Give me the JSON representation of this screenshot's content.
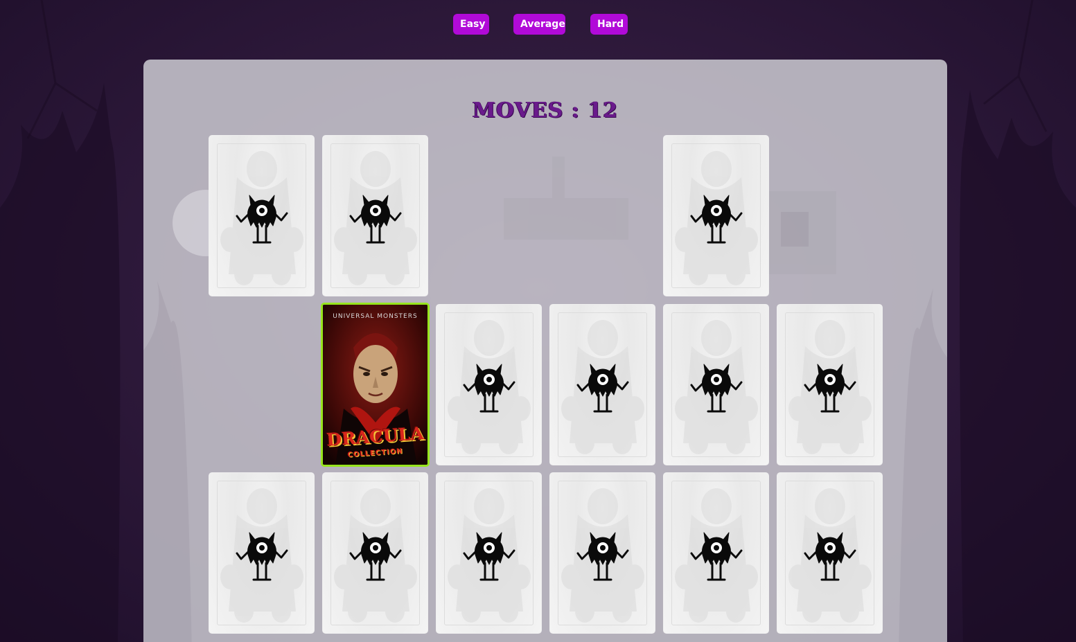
{
  "difficulty": {
    "options": [
      {
        "label": "Easy"
      },
      {
        "label": "Average"
      },
      {
        "label": "Hard"
      }
    ],
    "color": "#b10ad8"
  },
  "game": {
    "moves_label": "MOVES",
    "moves_separator": " : ",
    "moves_count": "12",
    "grid": {
      "columns": 6,
      "rows": 3
    },
    "cards": [
      {
        "row": 1,
        "col": 1,
        "state": "face-down"
      },
      {
        "row": 1,
        "col": 2,
        "state": "face-down"
      },
      {
        "row": 1,
        "col": 3,
        "state": "matched"
      },
      {
        "row": 1,
        "col": 4,
        "state": "matched"
      },
      {
        "row": 1,
        "col": 5,
        "state": "face-down"
      },
      {
        "row": 1,
        "col": 6,
        "state": "matched"
      },
      {
        "row": 2,
        "col": 1,
        "state": "matched"
      },
      {
        "row": 2,
        "col": 2,
        "state": "face-up",
        "front": {
          "brand": "UNIVERSAL MONSTERS",
          "title": "DRACULA",
          "subtitle": "COLLECTION"
        }
      },
      {
        "row": 2,
        "col": 3,
        "state": "face-down"
      },
      {
        "row": 2,
        "col": 4,
        "state": "face-down"
      },
      {
        "row": 2,
        "col": 5,
        "state": "face-down"
      },
      {
        "row": 2,
        "col": 6,
        "state": "face-down"
      },
      {
        "row": 3,
        "col": 1,
        "state": "face-down"
      },
      {
        "row": 3,
        "col": 2,
        "state": "face-down"
      },
      {
        "row": 3,
        "col": 3,
        "state": "face-down"
      },
      {
        "row": 3,
        "col": 4,
        "state": "face-down"
      },
      {
        "row": 3,
        "col": 5,
        "state": "face-down"
      },
      {
        "row": 3,
        "col": 6,
        "state": "face-down"
      }
    ],
    "card_back_icon": "one-eyed-monster-icon",
    "selected_border_color": "#97e51d"
  }
}
